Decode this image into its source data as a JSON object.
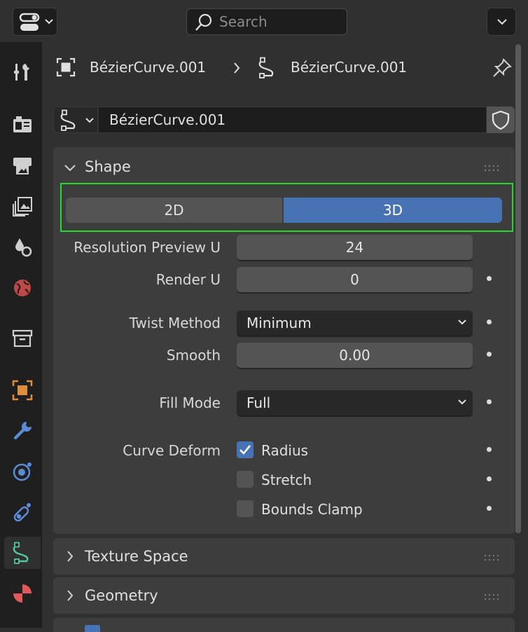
{
  "header": {
    "editor_type_icon": "properties-editor-icon",
    "search_placeholder": "Search",
    "options_icon": "chevron-down-icon"
  },
  "tabs": [
    {
      "name": "tool",
      "icon": "tool-icon"
    },
    {
      "name": "render",
      "icon": "render-icon"
    },
    {
      "name": "output",
      "icon": "output-icon"
    },
    {
      "name": "view-layer",
      "icon": "view-layer-icon"
    },
    {
      "name": "scene",
      "icon": "scene-icon"
    },
    {
      "name": "world",
      "icon": "world-icon"
    },
    {
      "name": "collection",
      "icon": "collection-icon"
    },
    {
      "name": "object",
      "icon": "object-icon"
    },
    {
      "name": "modifiers",
      "icon": "wrench-icon"
    },
    {
      "name": "physics",
      "icon": "physics-icon"
    },
    {
      "name": "constraints",
      "icon": "constraint-icon"
    },
    {
      "name": "data",
      "icon": "curve-data-icon",
      "active": true
    },
    {
      "name": "material",
      "icon": "material-icon"
    }
  ],
  "breadcrumb": {
    "object_name": "BézierCurve.001",
    "data_name": "BézierCurve.001"
  },
  "datablock": {
    "name": "BézierCurve.001"
  },
  "shape_panel": {
    "title": "Shape",
    "dimensions": {
      "option_2d": "2D",
      "option_3d": "3D",
      "selected": "3D"
    },
    "resolution_preview_u": {
      "label": "Resolution Preview U",
      "value": "24"
    },
    "render_u": {
      "label": "Render U",
      "value": "0"
    },
    "twist_method": {
      "label": "Twist Method",
      "value": "Minimum"
    },
    "smooth": {
      "label": "Smooth",
      "value": "0.00"
    },
    "fill_mode": {
      "label": "Fill Mode",
      "value": "Full"
    },
    "curve_deform": {
      "label": "Curve Deform",
      "options": [
        {
          "label": "Radius",
          "checked": true
        },
        {
          "label": "Stretch",
          "checked": false
        },
        {
          "label": "Bounds Clamp",
          "checked": false
        }
      ]
    }
  },
  "collapsed_panels": {
    "texture_space": "Texture Space",
    "geometry": "Geometry"
  },
  "colors": {
    "accent": "#4772b3",
    "highlight_outline": "#1fdc2a",
    "panel_bg": "#3d3d3d",
    "editor_bg": "#303030"
  }
}
